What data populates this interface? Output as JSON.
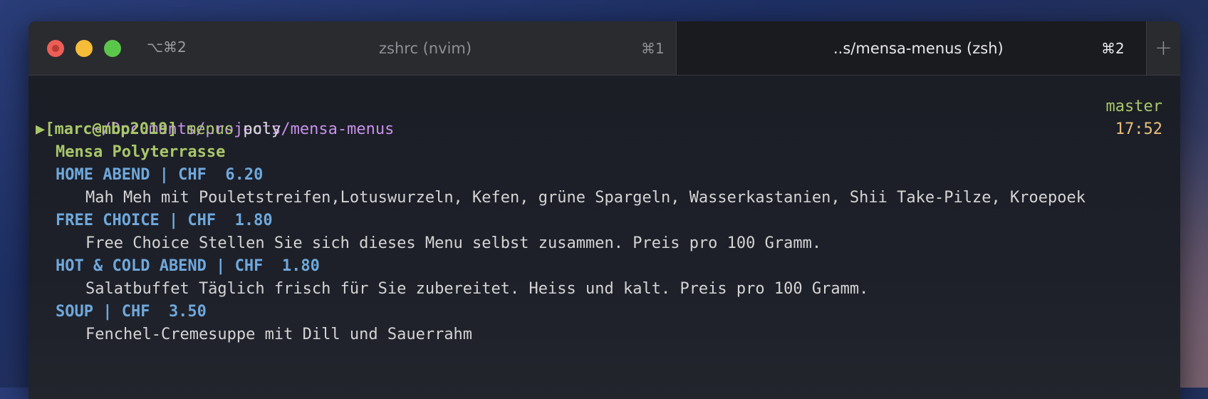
{
  "window": {
    "shortcut": "⌥⌘2",
    "new_tab_label": "+"
  },
  "tabs": [
    {
      "title": "zshrc (nvim)",
      "shortcut": "⌘1",
      "active": false
    },
    {
      "title": "..s/mensa-menus (zsh)",
      "shortcut": "⌘2",
      "active": true
    }
  ],
  "terminal": {
    "cwd": "~/Documents/projects/mensa-menus",
    "git_branch": "master",
    "prompt_arrow": "▶",
    "prompt_user": "[marc@mbp2019]",
    "command": "menus",
    "argument": "poly",
    "time": "17:52",
    "mensa_name": "Mensa Polyterrasse",
    "menus": [
      {
        "heading": "HOME ABEND | CHF  6.20",
        "description": "Mah Meh mit Pouletstreifen,Lotuswurzeln, Kefen, grüne Spargeln, Wasserkastanien, Shii Take-Pilze, Kroepoek"
      },
      {
        "heading": "FREE CHOICE | CHF  1.80",
        "description": "Free Choice Stellen Sie sich dieses Menu selbst zusammen. Preis pro 100 Gramm."
      },
      {
        "heading": "HOT & COLD ABEND | CHF  1.80",
        "description": "Salatbuffet Täglich frisch für Sie zubereitet. Heiss und kalt. Preis pro 100 Gramm."
      },
      {
        "heading": "SOUP | CHF  3.50",
        "description": "Fenchel-Cremesuppe mit Dill und Sauerrahm"
      }
    ]
  },
  "colors": {
    "close": "#ec5f57",
    "minimize": "#f5bd38",
    "maximize": "#5bc74a",
    "path": "#c792ea",
    "green": "#a9c76a",
    "heading": "#6fa8dc",
    "time": "#e6c07b"
  }
}
